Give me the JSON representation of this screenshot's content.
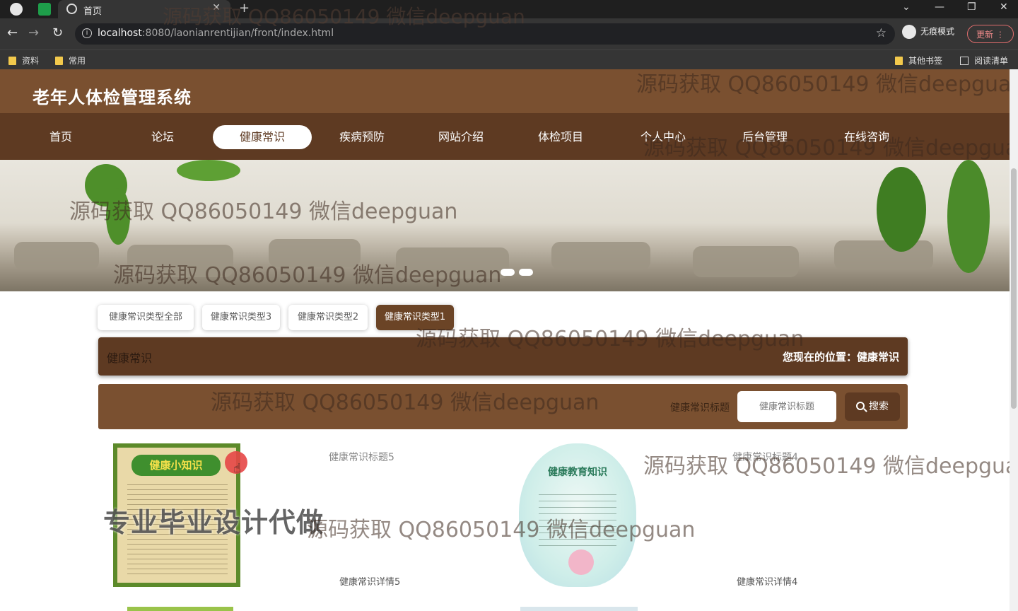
{
  "browser": {
    "tab_title": "首页",
    "url_host": "localhost",
    "url_rest": ":8080/laonianrentijian/front/index.html",
    "incognito_label": "无痕模式",
    "update_label": "更新",
    "bookmarks": [
      "资料",
      "常用"
    ],
    "bookmarks_right": [
      "其他书签",
      "阅读清单"
    ]
  },
  "site": {
    "title": "老年人体检管理系统",
    "nav": [
      "首页",
      "论坛",
      "健康常识",
      "疾病预防",
      "网站介绍",
      "体检项目",
      "个人中心",
      "后台管理",
      "在线咨询"
    ],
    "active_nav": "健康常识"
  },
  "categories": {
    "items": [
      "健康常识类型全部",
      "健康常识类型3",
      "健康常识类型2",
      "健康常识类型1"
    ],
    "active": "健康常识类型1"
  },
  "section": {
    "label": "健康常识",
    "location_label": "您现在的位置：",
    "location_value": "健康常识"
  },
  "search": {
    "label": "健康常识标题",
    "placeholder": "健康常识标题",
    "button": "搜索"
  },
  "cards": [
    {
      "poster_heading": "健康小知识",
      "title": "健康常识标题5",
      "detail": "健康常识详情5"
    },
    {
      "poster_heading": "健康教育知识",
      "title": "健康常识标题4",
      "detail": "健康常识详情4"
    }
  ],
  "overlay_text": {
    "promo": "专业毕业设计代做",
    "watermark": "源码获取 QQ86050149 微信deepguan"
  },
  "colors": {
    "header": "#7a5030",
    "nav": "#5e3a22",
    "accent": "#6b4426"
  }
}
